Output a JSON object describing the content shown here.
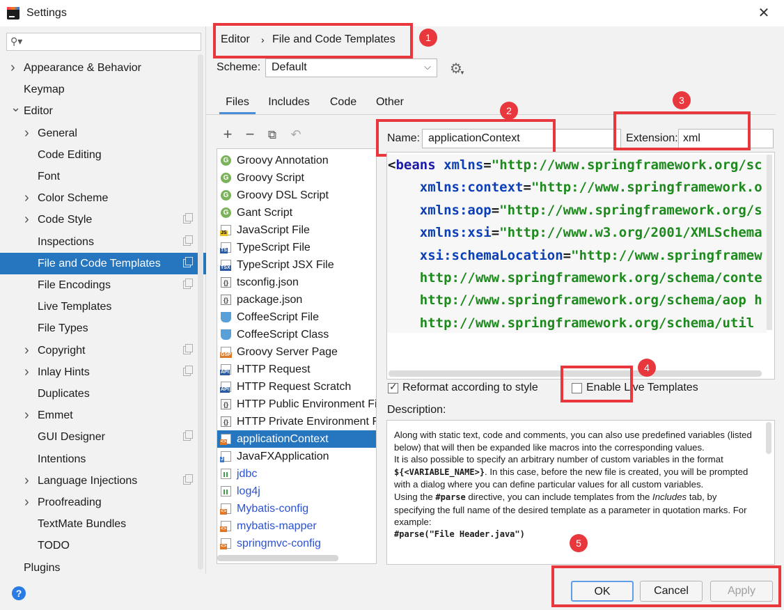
{
  "window": {
    "title": "Settings"
  },
  "sidebar": {
    "search_placeholder": "",
    "items": [
      {
        "label": "Appearance & Behavior",
        "arrow": true,
        "indent": 0
      },
      {
        "label": "Keymap",
        "arrow": false,
        "indent": 0
      },
      {
        "label": "Editor",
        "arrow": "open",
        "indent": 0
      },
      {
        "label": "General",
        "arrow": true,
        "indent": 1
      },
      {
        "label": "Code Editing",
        "arrow": false,
        "indent": 1
      },
      {
        "label": "Font",
        "arrow": false,
        "indent": 1
      },
      {
        "label": "Color Scheme",
        "arrow": true,
        "indent": 1
      },
      {
        "label": "Code Style",
        "arrow": true,
        "indent": 1,
        "copy": true
      },
      {
        "label": "Inspections",
        "arrow": false,
        "indent": 1,
        "copy": true
      },
      {
        "label": "File and Code Templates",
        "arrow": false,
        "indent": 1,
        "copy": true,
        "selected": true
      },
      {
        "label": "File Encodings",
        "arrow": false,
        "indent": 1,
        "copy": true
      },
      {
        "label": "Live Templates",
        "arrow": false,
        "indent": 1
      },
      {
        "label": "File Types",
        "arrow": false,
        "indent": 1
      },
      {
        "label": "Copyright",
        "arrow": true,
        "indent": 1,
        "copy": true
      },
      {
        "label": "Inlay Hints",
        "arrow": true,
        "indent": 1,
        "copy": true
      },
      {
        "label": "Duplicates",
        "arrow": false,
        "indent": 1
      },
      {
        "label": "Emmet",
        "arrow": true,
        "indent": 1
      },
      {
        "label": "GUI Designer",
        "arrow": false,
        "indent": 1,
        "copy": true
      },
      {
        "label": "Intentions",
        "arrow": false,
        "indent": 1
      },
      {
        "label": "Language Injections",
        "arrow": true,
        "indent": 1,
        "copy": true
      },
      {
        "label": "Proofreading",
        "arrow": true,
        "indent": 1
      },
      {
        "label": "TextMate Bundles",
        "arrow": false,
        "indent": 1
      },
      {
        "label": "TODO",
        "arrow": false,
        "indent": 1
      },
      {
        "label": "Plugins",
        "arrow": false,
        "indent": 0
      }
    ],
    "help": "?"
  },
  "breadcrumb": {
    "parent": "Editor",
    "separator": "›",
    "current": "File and Code Templates"
  },
  "scheme": {
    "label": "Scheme:",
    "value": "Default"
  },
  "tabs": [
    "Files",
    "Includes",
    "Code",
    "Other"
  ],
  "file_list": {
    "items": [
      {
        "label": "Groovy Annotation",
        "icon": "groovy",
        "icon_text": "G"
      },
      {
        "label": "Groovy Script",
        "icon": "groovy",
        "icon_text": "G"
      },
      {
        "label": "Groovy DSL Script",
        "icon": "groovy",
        "icon_text": "G"
      },
      {
        "label": "Gant Script",
        "icon": "groovy",
        "icon_text": "G"
      },
      {
        "label": "JavaScript File",
        "icon": "js",
        "icon_text": "JS"
      },
      {
        "label": "TypeScript File",
        "icon": "doc",
        "icon_text": "TS"
      },
      {
        "label": "TypeScript JSX File",
        "icon": "doc",
        "icon_text": "TSX"
      },
      {
        "label": "tsconfig.json",
        "icon": "json",
        "icon_text": "{}"
      },
      {
        "label": "package.json",
        "icon": "json",
        "icon_text": "{}"
      },
      {
        "label": "CoffeeScript File",
        "icon": "coffee",
        "icon_text": ""
      },
      {
        "label": "CoffeeScript Class",
        "icon": "coffee",
        "icon_text": ""
      },
      {
        "label": "Groovy Server Page",
        "icon": "gsp",
        "icon_text": "GSP"
      },
      {
        "label": "HTTP Request",
        "icon": "doc",
        "icon_text": "API"
      },
      {
        "label": "HTTP Request Scratch",
        "icon": "doc",
        "icon_text": "API"
      },
      {
        "label": "HTTP Public Environment File",
        "icon": "json",
        "icon_text": "{}"
      },
      {
        "label": "HTTP Private Environment File",
        "icon": "json",
        "icon_text": "{}"
      },
      {
        "label": "applicationContext",
        "icon": "xml",
        "icon_text": "<>",
        "selected": true
      },
      {
        "label": "JavaFXApplication",
        "icon": "java",
        "icon_text": "J"
      },
      {
        "label": "jdbc",
        "icon": "bar",
        "icon_text": "",
        "blue": true
      },
      {
        "label": "log4j",
        "icon": "bar",
        "icon_text": "",
        "blue": true
      },
      {
        "label": "Mybatis-config",
        "icon": "xml",
        "icon_text": "<>",
        "blue": true
      },
      {
        "label": "mybatis-mapper",
        "icon": "xml",
        "icon_text": "<>",
        "blue": true
      },
      {
        "label": "springmvc-config",
        "icon": "xml",
        "icon_text": "<>",
        "blue": true
      }
    ]
  },
  "template": {
    "name_label": "Name:",
    "name_value": "applicationContext",
    "ext_label": "Extension:",
    "ext_value": "xml"
  },
  "code": [
    [
      [
        "c-punct",
        "<"
      ],
      [
        "c-tag",
        "beans "
      ],
      [
        "c-attr",
        "xmlns"
      ],
      [
        "c-punct",
        "="
      ],
      [
        "c-val",
        "\"http://www.springframework.org/sc"
      ]
    ],
    [
      [
        "c-punct",
        "    "
      ],
      [
        "c-attr",
        "xmlns:context"
      ],
      [
        "c-punct",
        "="
      ],
      [
        "c-val",
        "\"http://www.springframework.o"
      ]
    ],
    [
      [
        "c-punct",
        "    "
      ],
      [
        "c-attr",
        "xmlns:aop"
      ],
      [
        "c-punct",
        "="
      ],
      [
        "c-val",
        "\"http://www.springframework.org/s"
      ]
    ],
    [
      [
        "c-punct",
        "    "
      ],
      [
        "c-attr",
        "xmlns:xsi"
      ],
      [
        "c-punct",
        "="
      ],
      [
        "c-val",
        "\"http://www.w3.org/2001/XMLSchema"
      ]
    ],
    [
      [
        "c-punct",
        "    "
      ],
      [
        "c-attr",
        "xsi:schemaLocation"
      ],
      [
        "c-punct",
        "="
      ],
      [
        "c-val",
        "\"http://www.springframew"
      ]
    ],
    [
      [
        "c-punct",
        "    "
      ],
      [
        "c-val",
        "http://www.springframework.org/schema/conte"
      ]
    ],
    [
      [
        "c-punct",
        "    "
      ],
      [
        "c-val",
        "http://www.springframework.org/schema/aop h"
      ]
    ],
    [
      [
        "c-punct",
        "    "
      ],
      [
        "c-val",
        "http://www.springframework.org/schema/util"
      ]
    ]
  ],
  "options": {
    "reformat_label": "Reformat according to style",
    "reformat_checked": true,
    "live_templates_label": "Enable Live Templates",
    "live_templates_checked": false
  },
  "description": {
    "label": "Description:",
    "paragraph_1": "Along with static text, code and comments, you can also use predefined variables (listed below) that will then be expanded like macros into the corresponding values.",
    "p2_before": "It is also possible to specify an arbitrary number of custom variables in the format ",
    "p2_code": "${<VARIABLE_NAME>}",
    "p2_after": ". In this case, before the new file is created, you will be prompted with a dialog where you can define particular values for all custom variables.",
    "p3_before": "Using the ",
    "p3_code": "#parse",
    "p3_mid": " directive, you can include templates from the ",
    "p3_italic": "Includes",
    "p3_after": " tab, by specifying the full name of the desired template as a parameter in quotation marks. For example:",
    "example": "#parse(\"File Header.java\")"
  },
  "buttons": {
    "ok": "OK",
    "cancel": "Cancel",
    "apply": "Apply"
  },
  "annotations": [
    "1",
    "2",
    "3",
    "4",
    "5"
  ],
  "colors": {
    "selection": "#2675bf",
    "annotation_red": "#e8383d",
    "link_blue": "#2a52d6"
  }
}
